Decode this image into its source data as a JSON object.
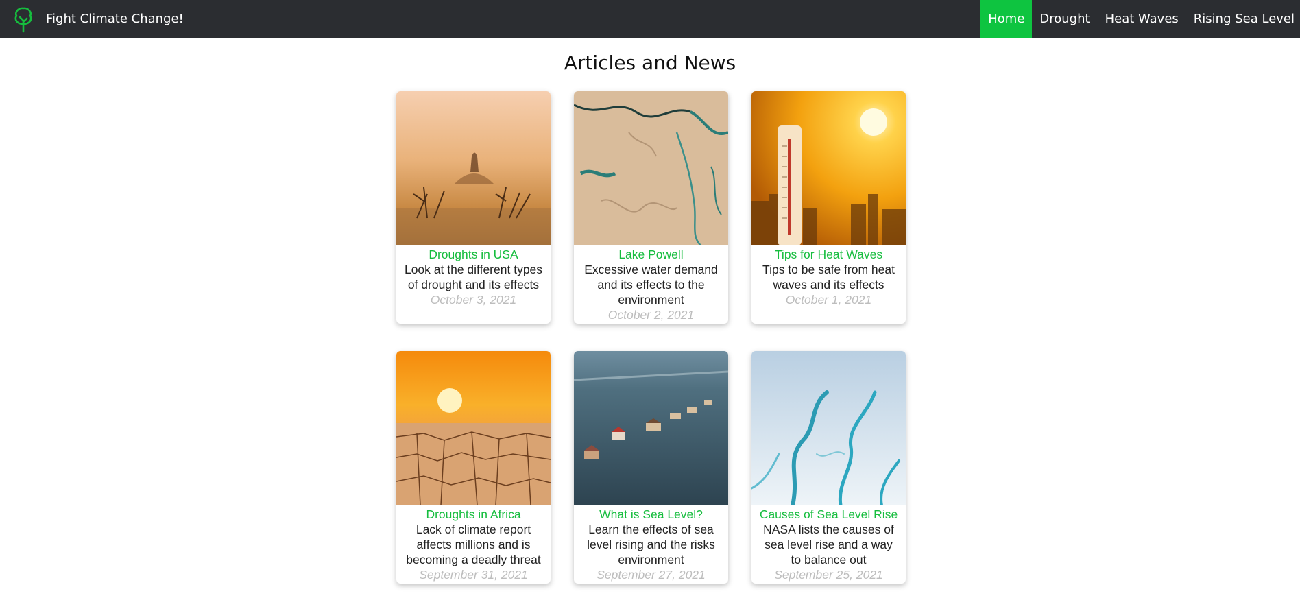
{
  "navbar": {
    "brand": "Fight Climate Change!",
    "links": [
      "Home",
      "Drought",
      "Heat Waves",
      "Rising Sea Level"
    ]
  },
  "page_title": "Articles and News",
  "articles": [
    {
      "title": "Droughts in USA",
      "desc": "Look at the different types of drought and its effects",
      "date": "October 3, 2021"
    },
    {
      "title": "Lake Powell",
      "desc": "Excessive water demand and its effects to the environment",
      "date": "October 2, 2021"
    },
    {
      "title": "Tips for Heat Waves",
      "desc": "Tips to be safe from heat waves and its effects",
      "date": "October 1, 2021"
    },
    {
      "title": "Droughts in Africa",
      "desc": "Lack of climate report affects millions and is becoming a deadly threat",
      "date": "September 31, 2021"
    },
    {
      "title": "What is Sea Level?",
      "desc": "Learn the effects of sea level rising and the risks environment",
      "date": "September 27, 2021"
    },
    {
      "title": "Causes of Sea Level Rise",
      "desc": "NASA lists the causes of sea level rise and a way to balance out",
      "date": "September 25, 2021"
    }
  ],
  "colors": {
    "navbar_bg": "#2b2d31",
    "accent_green": "#0ec440",
    "title_green": "#16bd3e",
    "date_gray": "#bdbdbd"
  },
  "icons": {
    "brand": "tree-icon"
  }
}
